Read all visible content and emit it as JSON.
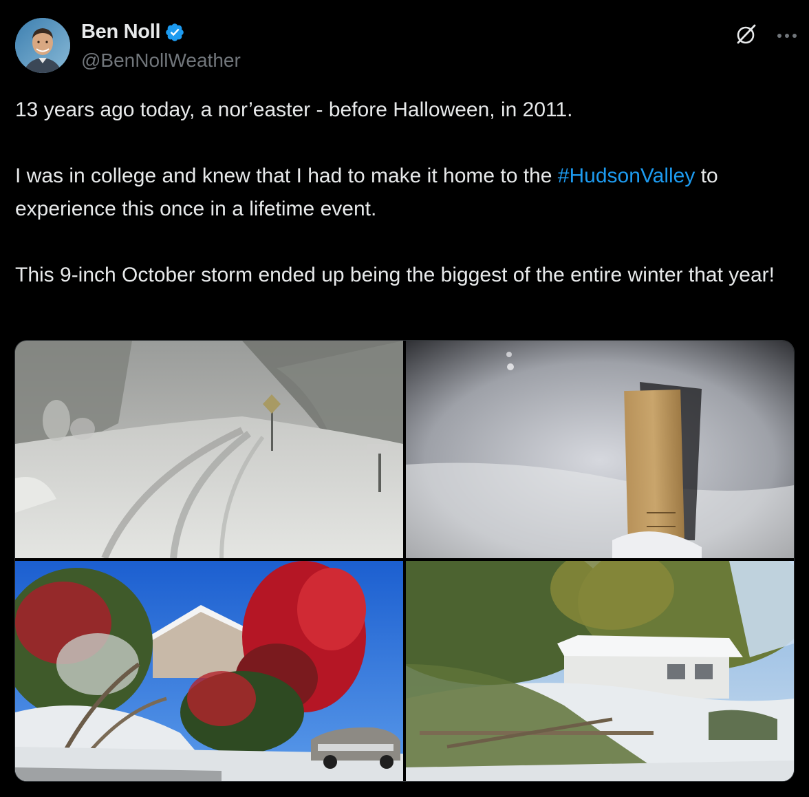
{
  "author": {
    "display_name": "Ben Noll",
    "handle": "@BenNollWeather",
    "verified": true,
    "avatar_icon": "avatar-photo"
  },
  "actions": {
    "grok_icon": "grok-icon",
    "more_icon": "more-options-icon"
  },
  "tweet": {
    "line1": "13 years ago today, a nor’easter - before Halloween, in 2011.",
    "para2_before": "I was in college and knew that I had to make it home to the ",
    "hashtag": "#HudsonValley",
    "para2_after": " to experience this once in a lifetime event.",
    "para3": "This 9-inch October storm ended up being the biggest of the entire winter that year!"
  },
  "media": {
    "photos": [
      {
        "name": "snowy-road-photo"
      },
      {
        "name": "snow-ruler-photo"
      },
      {
        "name": "red-tree-snow-photo"
      },
      {
        "name": "fallen-trees-house-photo"
      }
    ]
  },
  "colors": {
    "background": "#000000",
    "text": "#e7e9ea",
    "secondary": "#71767b",
    "link": "#1d9bf0",
    "verified": "#1d9bf0"
  }
}
